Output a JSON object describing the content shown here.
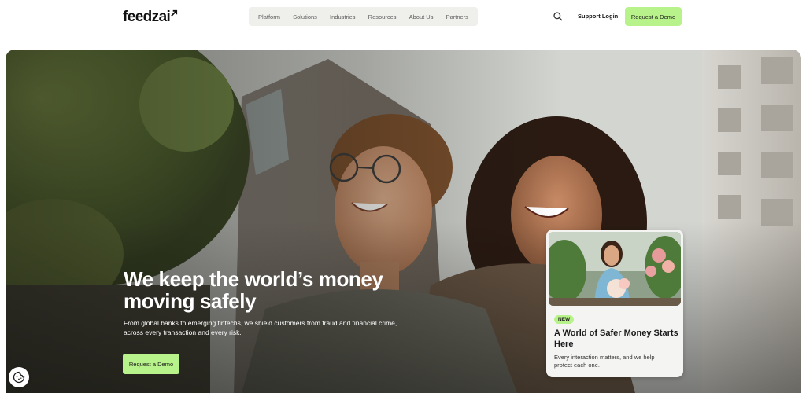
{
  "brand": {
    "name": "feedzai",
    "accent_color": "#b8f28a"
  },
  "nav": {
    "items": [
      {
        "label": "Platform"
      },
      {
        "label": "Solutions"
      },
      {
        "label": "Industries"
      },
      {
        "label": "Resources"
      },
      {
        "label": "About Us"
      },
      {
        "label": "Partners"
      }
    ]
  },
  "header": {
    "search_icon": "search-icon",
    "support_login": "Support Login",
    "request_demo": "Request a Demo"
  },
  "hero": {
    "title": "We keep the world’s money moving safely",
    "subtitle": "From global banks to emerging fintechs, we shield customers from fraud and financial crime, across every transaction and every risk.",
    "cta": "Request a Demo"
  },
  "card": {
    "badge": "NEW",
    "title": "A World of Safer Money Starts Here",
    "description": "Every interaction matters, and we help protect each one."
  },
  "cookie": {
    "icon": "cookie-icon"
  }
}
